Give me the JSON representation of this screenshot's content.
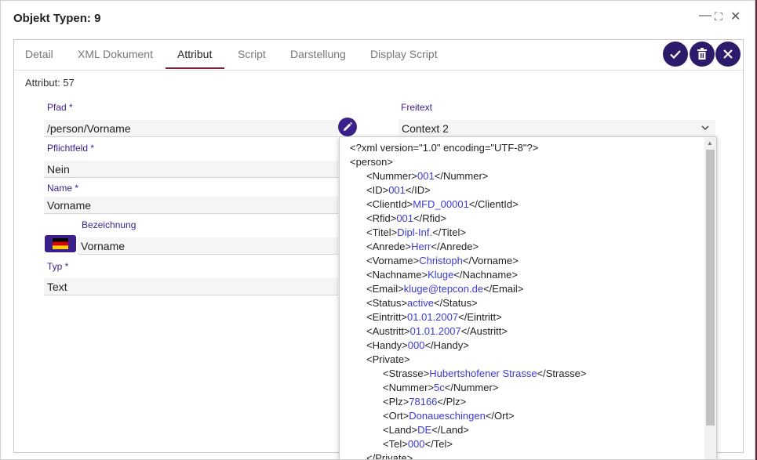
{
  "dialog": {
    "title": "Objekt Typen: 9",
    "controls": {
      "minimize": "—",
      "maximize": "⛶",
      "close": "✕"
    }
  },
  "tabs": [
    {
      "label": "Detail",
      "active": false
    },
    {
      "label": "XML Dokument",
      "active": false
    },
    {
      "label": "Attribut",
      "active": true
    },
    {
      "label": "Script",
      "active": false
    },
    {
      "label": "Darstellung",
      "active": false
    },
    {
      "label": "Display Script",
      "active": false
    }
  ],
  "actions": {
    "confirm_icon": "check-icon",
    "delete_icon": "trash-icon",
    "close_icon": "close-icon"
  },
  "form": {
    "header": "Attribut: 57",
    "pfad": {
      "label": "Pfad *",
      "value": "/person/Vorname"
    },
    "freitext": {
      "label": "Freitext",
      "value": "Context 2"
    },
    "pflichtfeld": {
      "label": "Pflichtfeld *",
      "value": "Nein"
    },
    "name": {
      "label": "Name *",
      "value": "Vorname"
    },
    "bezeichnung": {
      "label": "Bezeichnung",
      "value": "Vorname",
      "flag": "de-flag-icon"
    },
    "typ": {
      "label": "Typ *",
      "value": "Text"
    }
  },
  "xml_dropdown": {
    "lines": [
      {
        "pre": "<?xml version=\"1.0\" encoding=\"UTF-8\"?>",
        "val": "",
        "post": "",
        "indent": 0
      },
      {
        "pre": "<person>",
        "val": "",
        "post": "",
        "indent": 0
      },
      {
        "pre": "<Nummer>",
        "val": "001",
        "post": "</Nummer>",
        "indent": 1
      },
      {
        "pre": "<ID>",
        "val": "001",
        "post": "</ID>",
        "indent": 1
      },
      {
        "pre": "<ClientId>",
        "val": "MFD_00001",
        "post": "</ClientId>",
        "indent": 1
      },
      {
        "pre": "<Rfid>",
        "val": "001",
        "post": "</Rfid>",
        "indent": 1
      },
      {
        "pre": "<Titel>",
        "val": "Dipl-Inf.",
        "post": "</Titel>",
        "indent": 1
      },
      {
        "pre": "<Anrede>",
        "val": "Herr",
        "post": "</Anrede>",
        "indent": 1
      },
      {
        "pre": "<Vorname>",
        "val": "Christoph",
        "post": "</Vorname>",
        "indent": 1
      },
      {
        "pre": "<Nachname>",
        "val": "Kluge",
        "post": "</Nachname>",
        "indent": 1
      },
      {
        "pre": "<Email>",
        "val": "kluge@tepcon.de",
        "post": "</Email>",
        "indent": 1
      },
      {
        "pre": "<Status>",
        "val": "active",
        "post": "</Status>",
        "indent": 1
      },
      {
        "pre": "<Eintritt>",
        "val": "01.01.2007",
        "post": "</Eintritt>",
        "indent": 1
      },
      {
        "pre": "<Austritt>",
        "val": "01.01.2007",
        "post": "</Austritt>",
        "indent": 1
      },
      {
        "pre": "<Handy>",
        "val": "000",
        "post": "</Handy>",
        "indent": 1
      },
      {
        "pre": "<Private>",
        "val": "",
        "post": "",
        "indent": 1
      },
      {
        "pre": "<Strasse>",
        "val": "Hubertshofener Strasse",
        "post": "</Strasse>",
        "indent": 2
      },
      {
        "pre": "<Nummer>",
        "val": "5c",
        "post": "</Nummer>",
        "indent": 2
      },
      {
        "pre": "<Plz>",
        "val": "78166",
        "post": "</Plz>",
        "indent": 2
      },
      {
        "pre": "<Ort>",
        "val": "Donaueschingen",
        "post": "</Ort>",
        "indent": 2
      },
      {
        "pre": "<Land>",
        "val": "DE",
        "post": "</Land>",
        "indent": 2
      },
      {
        "pre": "<Tel>",
        "val": "000",
        "post": "</Tel>",
        "indent": 2
      },
      {
        "pre": "</Private>",
        "val": "",
        "post": "",
        "indent": 1
      }
    ]
  },
  "colors": {
    "accent": "#3b1f8a",
    "tab_underline": "#7a1f3d",
    "xml_value": "#3b3bd1"
  }
}
